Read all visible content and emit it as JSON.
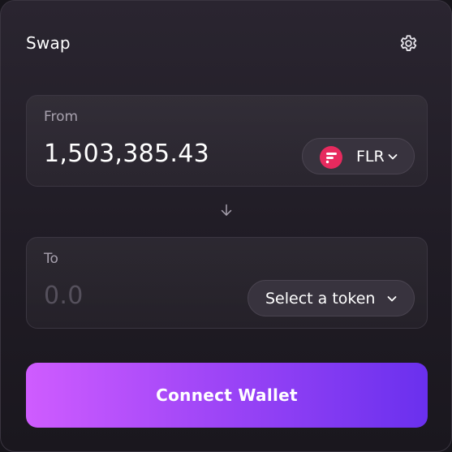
{
  "header": {
    "title": "Swap",
    "settings_icon": "gear-icon"
  },
  "from": {
    "label": "From",
    "amount": "1,503,385.43",
    "token": {
      "symbol": "FLR",
      "logo_icon": "flare-logo-icon",
      "logo_color": "#e72a5e"
    }
  },
  "direction_icon": "arrow-down-icon",
  "to": {
    "label": "To",
    "amount_placeholder": "0.0",
    "select_label": "Select a token"
  },
  "connect_button": {
    "label": "Connect Wallet",
    "gradient_start": "#cf5cff",
    "gradient_end": "#6a30ee"
  }
}
